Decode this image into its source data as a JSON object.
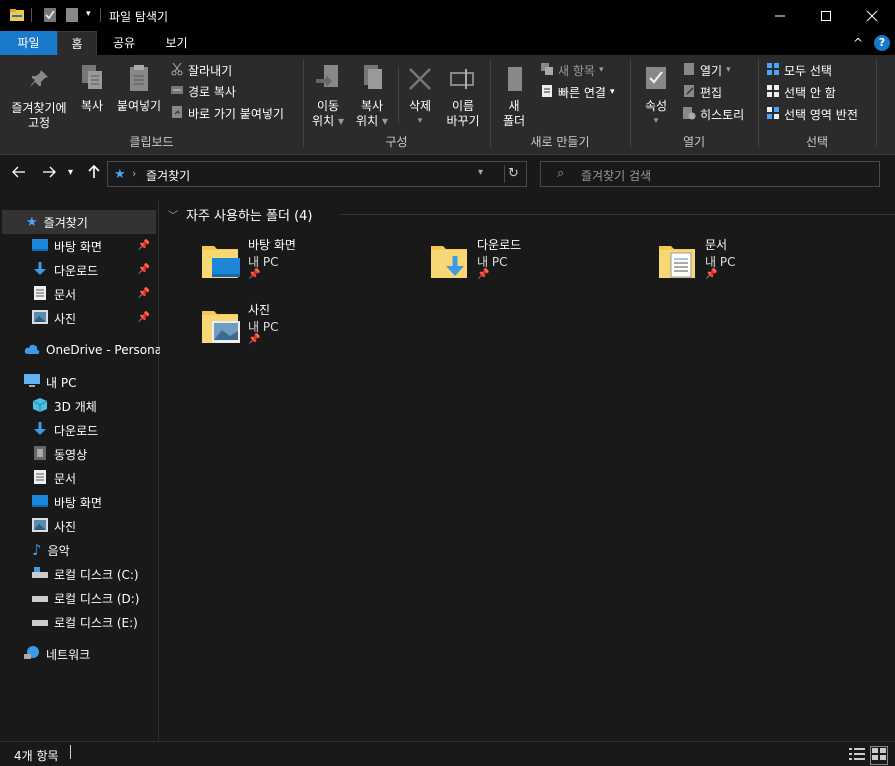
{
  "window": {
    "title": "파일 탐색기",
    "controls": [
      "minimize",
      "maximize",
      "close"
    ]
  },
  "ribbon_tabs": [
    {
      "label": "파일",
      "active": false
    },
    {
      "label": "홈",
      "active": true
    },
    {
      "label": "공유",
      "active": false
    },
    {
      "label": "보기",
      "active": false
    }
  ],
  "ribbon": {
    "clipboard": {
      "label": "클립보드",
      "pin_quick_access": "즐겨찾기에\n고정",
      "pin_line1": "즐겨찾기에",
      "pin_line2": "고정",
      "copy": "복사",
      "paste": "붙여넣기",
      "cut": "잘라내기",
      "copy_path": "경로 복사",
      "paste_shortcut": "바로 가기 붙여넣기"
    },
    "organize": {
      "label": "구성",
      "move_to_1": "이동",
      "move_to_2": "위치",
      "copy_to_1": "복사",
      "copy_to_2": "위치",
      "delete": "삭제",
      "rename_1": "이름",
      "rename_2": "바꾸기"
    },
    "new": {
      "label": "새로 만들기",
      "new_folder_1": "새",
      "new_folder_2": "폴더",
      "new_item": "새 항목",
      "easy_access": "빠른 연결"
    },
    "open": {
      "label": "열기",
      "properties": "속성",
      "open": "열기",
      "edit": "편집",
      "history": "히스토리"
    },
    "select": {
      "label": "선택",
      "select_all": "모두 선택",
      "select_none": "선택 안 함",
      "invert_selection": "선택 영역 반전"
    }
  },
  "address": {
    "path": "즐겨찾기",
    "search_placeholder": "즐겨찾기 검색"
  },
  "sidebar": {
    "quick_access": {
      "label": "즐겨찾기",
      "items": [
        "바탕 화면",
        "다운로드",
        "문서",
        "사진"
      ]
    },
    "onedrive": "OneDrive - Personal",
    "this_pc": {
      "label": "내 PC",
      "items": [
        "3D 개체",
        "다운로드",
        "동영상",
        "문서",
        "바탕 화면",
        "사진",
        "음악",
        "로컬 디스크 (C:)",
        "로컬 디스크 (D:)",
        "로컬 디스크 (E:)"
      ]
    },
    "network": "네트워크"
  },
  "content": {
    "section_title": "자주 사용하는 폴더 (4)",
    "folders": [
      {
        "name": "바탕 화면",
        "location": "내 PC"
      },
      {
        "name": "다운로드",
        "location": "내 PC"
      },
      {
        "name": "문서",
        "location": "내 PC"
      },
      {
        "name": "사진",
        "location": "내 PC"
      }
    ]
  },
  "statusbar": {
    "item_count": "4개 항목"
  },
  "colors": {
    "accent": "#1979ca",
    "background": "#191919",
    "ribbon": "#2b2b2b",
    "folder": "#f3c94f"
  }
}
